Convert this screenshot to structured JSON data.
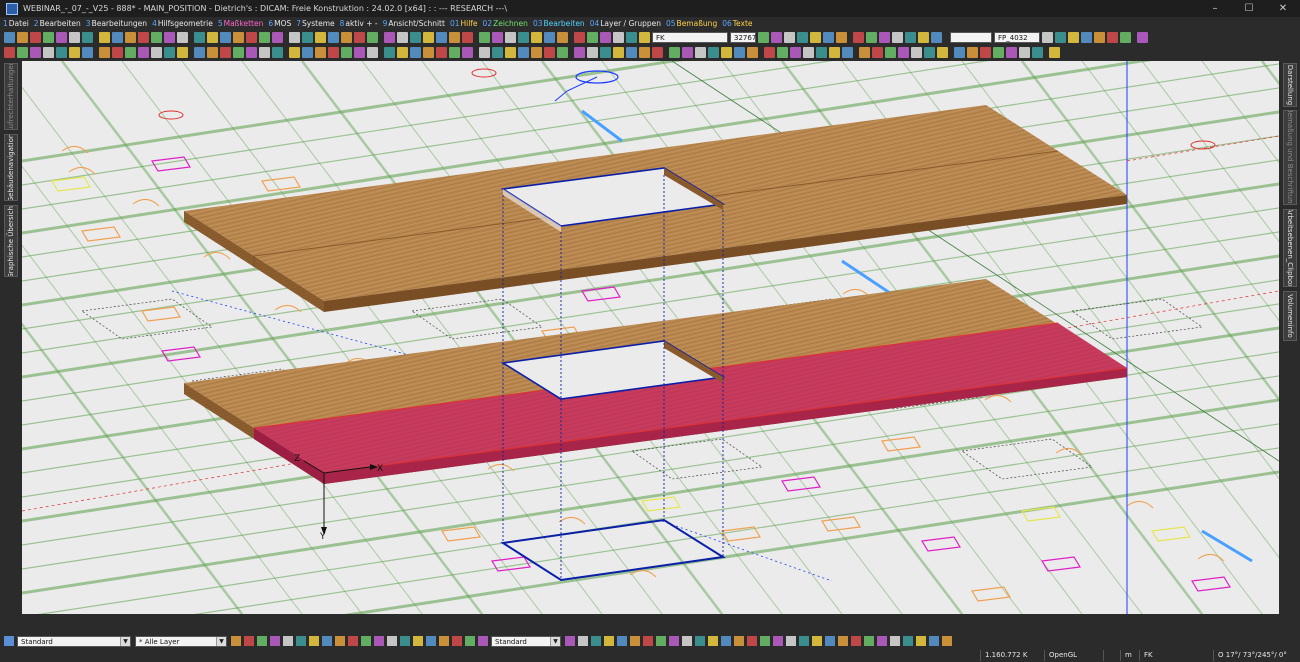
{
  "window": {
    "title": "WEBINAR_-_07_-_V25 - 888* - MAIN_POSITION - Dietrich's : DICAM: Freie Konstruktion : 24.02.0 [x64] : : --- RESEARCH ---\\",
    "minimize": "–",
    "maximize": "☐",
    "close": "✕"
  },
  "menu": [
    {
      "num": "1",
      "label": "Datei"
    },
    {
      "num": "2",
      "label": "Bearbeiten"
    },
    {
      "num": "3",
      "label": "Bearbeitungen"
    },
    {
      "num": "4",
      "label": "Hilfsgeometrie"
    },
    {
      "num": "5",
      "label": "Maßketten"
    },
    {
      "num": "6",
      "label": "MOS"
    },
    {
      "num": "7",
      "label": "Systeme"
    },
    {
      "num": "8",
      "label": "aktiv + -"
    },
    {
      "num": "9",
      "label": "Ansicht/Schnitt"
    },
    {
      "num": "01",
      "label": "Hilfe"
    },
    {
      "num": "02",
      "label": "Zeichnen"
    },
    {
      "num": "03",
      "label": "Bearbeiten"
    },
    {
      "num": "04",
      "label": "Layer / Gruppen"
    },
    {
      "num": "05",
      "label": "Bemaßung"
    },
    {
      "num": "06",
      "label": "Texte"
    }
  ],
  "toolbar1": {
    "layer_field": "FK",
    "number_field": "32767",
    "position_field": "FP_4032"
  },
  "left_tabs": [
    {
      "label": "Aufrechterhaltungen"
    },
    {
      "label": "Gebäudenavigation"
    },
    {
      "label": "Graphische Übersicht"
    }
  ],
  "right_tabs": [
    {
      "label": "Darstellung"
    },
    {
      "label": "Bemaßung und Beschriftung"
    },
    {
      "label": "Arbeitsebenen_Clipbox"
    },
    {
      "label": "Volumeninfo"
    }
  ],
  "viewport": {
    "axis_x_label": "X",
    "axis_y_label": "Y",
    "axis_z_label": "Z",
    "colors": {
      "background": "#ebebeb",
      "wood_top": "#b8874f",
      "wood_side": "#8a5a2c",
      "selection": "#c8345e",
      "opening": "#0a1fa8",
      "plan_green": "#5aa04a",
      "plan_magenta": "#e01ec8",
      "plan_orange": "#f0a050",
      "plan_red": "#e03030",
      "plan_yellow": "#e6e650"
    }
  },
  "bottom": {
    "style_combo": "Standard",
    "layer_combo": "* Alle Layer",
    "line_combo": "Standard"
  },
  "status": {
    "coordinates": "1.160.772 K",
    "renderer": "OpenGL",
    "unit": "m",
    "layer": "FK",
    "view": "O 17°/ 73°/245°/  0°"
  }
}
